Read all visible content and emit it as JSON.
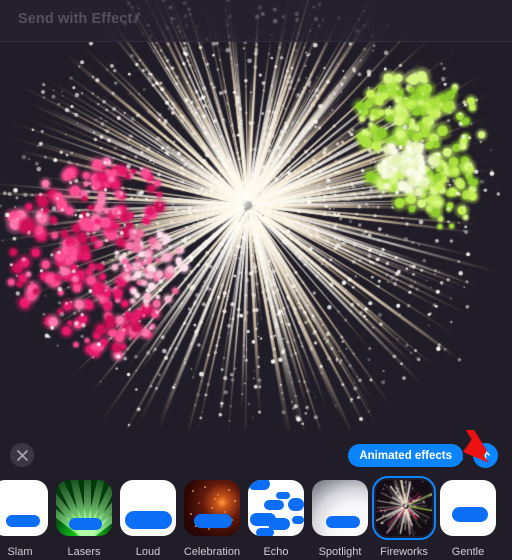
{
  "header": {
    "title": "Send with Effect"
  },
  "preview": {
    "effect_name": "Fireworks",
    "background_color": "#211d28",
    "particle_colors": [
      "#fffaf0",
      "#e8d9bc",
      "#b2e33c",
      "#e8186b"
    ]
  },
  "controls": {
    "close_icon": "close-icon",
    "pill_label": "Animated effects",
    "pill_color": "#0b84ff",
    "send_icon": "arrow-up-icon",
    "annotation_arrow_color": "#ee1111"
  },
  "effects": [
    {
      "id": "slam",
      "label": "Slam"
    },
    {
      "id": "lasers",
      "label": "Lasers"
    },
    {
      "id": "loud",
      "label": "Loud"
    },
    {
      "id": "celebration",
      "label": "Celebration"
    },
    {
      "id": "echo",
      "label": "Echo"
    },
    {
      "id": "spotlight",
      "label": "Spotlight"
    },
    {
      "id": "fireworks",
      "label": "Fireworks",
      "selected": true
    },
    {
      "id": "gentle",
      "label": "Gentle"
    }
  ]
}
